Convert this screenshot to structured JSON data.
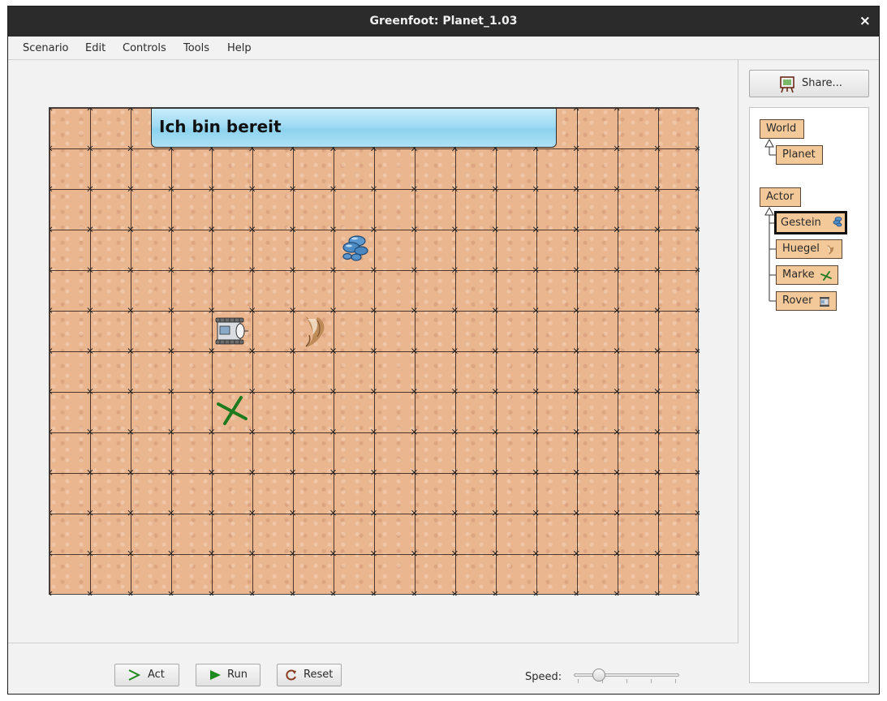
{
  "window": {
    "title": "Greenfoot: Planet_1.03",
    "close_glyph": "×"
  },
  "menu": {
    "items": [
      "Scenario",
      "Edit",
      "Controls",
      "Tools",
      "Help"
    ]
  },
  "world": {
    "banner_text": "Ich bin bereit",
    "grid": {
      "columns": 16,
      "rows": 12
    },
    "actors": [
      {
        "name": "gestein-rock",
        "icon": "rock-icon",
        "col": 7,
        "row": 3
      },
      {
        "name": "rover",
        "icon": "rover-icon",
        "col": 4,
        "row": 5
      },
      {
        "name": "huegel-hill",
        "icon": "hill-icon",
        "col": 6,
        "row": 5
      },
      {
        "name": "marke-marker",
        "icon": "x-marker-icon",
        "col": 4,
        "row": 7
      }
    ]
  },
  "controls": {
    "act_label": "Act",
    "run_label": "Run",
    "reset_label": "Reset",
    "speed_label": "Speed:",
    "speed_fraction": 0.2
  },
  "side": {
    "share_label": "Share...",
    "classes": {
      "world": "World",
      "planet": "Planet",
      "actor": "Actor",
      "gestein": "Gestein",
      "huegel": "Huegel",
      "marke": "Marke",
      "rover": "Rover"
    },
    "selected_class": "Gestein"
  },
  "colors": {
    "tile": "#e9b690",
    "class_box": "#f4c999",
    "banner": "#9fdbf3",
    "marker": "#1e7a1e"
  }
}
